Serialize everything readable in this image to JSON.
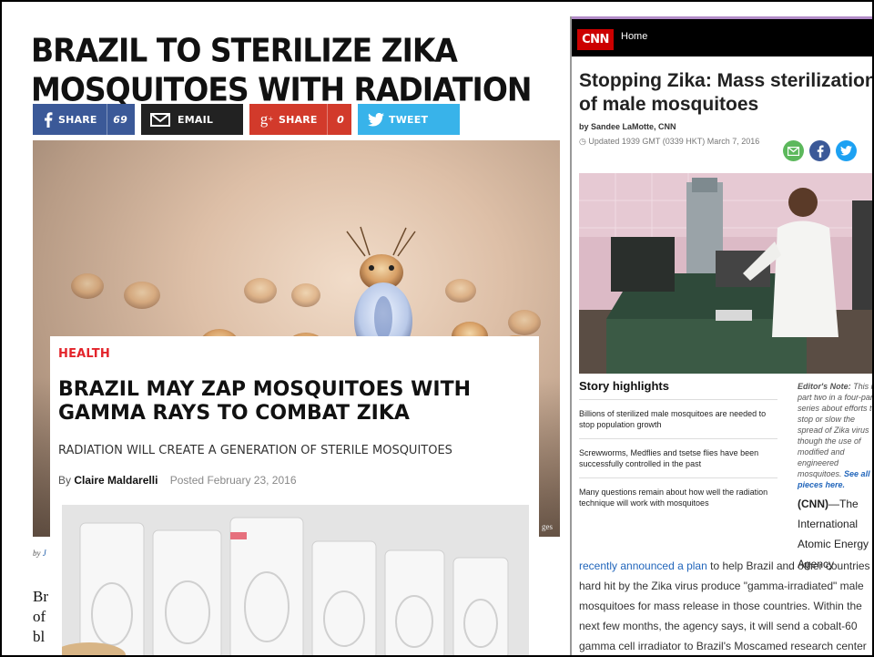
{
  "left_article": {
    "headline": "BRAZIL TO STERILIZE ZIKA MOSQUITOES WITH RADIATION",
    "share_buttons": [
      {
        "label": "SHARE",
        "count": "69",
        "icon": "facebook-icon",
        "color": "#3b5998"
      },
      {
        "label": "EMAIL",
        "icon": "mail-icon",
        "color": "#222222"
      },
      {
        "label": "SHARE",
        "count": "0",
        "icon": "google-plus-icon",
        "color": "#d23a2b"
      },
      {
        "label": "TWEET",
        "icon": "twitter-icon",
        "color": "#38b3ea"
      }
    ],
    "photo_credit": "ges",
    "byline_prefix": "by",
    "byline_name": "J",
    "body_fragment": [
      "Br",
      "of",
      "bl"
    ]
  },
  "popsci_card": {
    "category": "HEALTH",
    "headline": "BRAZIL MAY ZAP MOSQUITOES WITH GAMMA RAYS TO COMBAT ZIKA",
    "subhead": "RADIATION WILL CREATE A GENERATION OF STERILE MOSQUITOES",
    "byline_by": "By",
    "author": "Claire Maldarelli",
    "posted": "Posted February 23, 2016",
    "accent_color": "#e3242b"
  },
  "cnn": {
    "logo": "CNN",
    "nav_home": "Home",
    "title": "Stopping Zika: Mass sterilization of male mosquitoes",
    "byline": "by Sandee LaMotte, CNN",
    "updated": "Updated 1939 GMT (0339 HKT) March 7, 2016",
    "social_icons": [
      {
        "icon": "email-share-icon",
        "color": "#5cb85c"
      },
      {
        "icon": "facebook-share-icon",
        "color": "#3b5998"
      },
      {
        "icon": "twitter-share-icon",
        "color": "#1da1f2"
      }
    ],
    "highlights_title": "Story highlights",
    "highlights": [
      "Billions of sterilized male mosquitoes are needed to stop population growth",
      "Screwworms, Medflies and tsetse flies have been successfully controlled in the past",
      "Many questions remain about how well the radiation technique will work with mosquitoes"
    ],
    "editor_note_label": "Editor's Note:",
    "editor_note_text": "This is part two in a four-part series about efforts to stop or slow the spread of Zika virus though the use of modified and engineered mosquitoes.",
    "editor_note_link": "See all pieces here.",
    "dateline_tag": "(CNN)",
    "dateline_text": "—The International Atomic Energy Agency",
    "body_link": "recently announced a plan",
    "body_lines": [
      " to help Brazil and other countries",
      "hard hit by the Zika virus produce \"gamma-irradiated\" male",
      "mosquitoes for mass release in those countries. Within the",
      "next few months, the agency says, it will send a cobalt-60",
      "gamma cell irradiator to Brazil's Moscamed research center"
    ]
  }
}
